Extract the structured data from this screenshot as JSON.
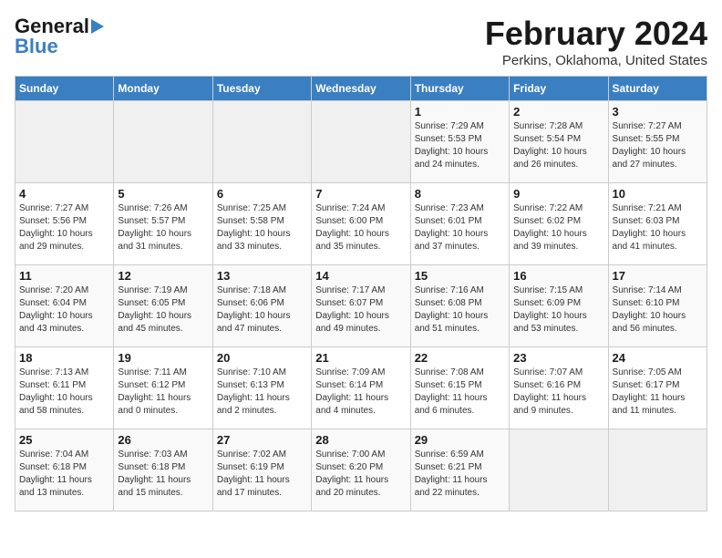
{
  "header": {
    "logo_line1": "General",
    "logo_line2": "Blue",
    "month_year": "February 2024",
    "location": "Perkins, Oklahoma, United States"
  },
  "weekdays": [
    "Sunday",
    "Monday",
    "Tuesday",
    "Wednesday",
    "Thursday",
    "Friday",
    "Saturday"
  ],
  "weeks": [
    [
      {
        "day": "",
        "info": ""
      },
      {
        "day": "",
        "info": ""
      },
      {
        "day": "",
        "info": ""
      },
      {
        "day": "",
        "info": ""
      },
      {
        "day": "1",
        "info": "Sunrise: 7:29 AM\nSunset: 5:53 PM\nDaylight: 10 hours\nand 24 minutes."
      },
      {
        "day": "2",
        "info": "Sunrise: 7:28 AM\nSunset: 5:54 PM\nDaylight: 10 hours\nand 26 minutes."
      },
      {
        "day": "3",
        "info": "Sunrise: 7:27 AM\nSunset: 5:55 PM\nDaylight: 10 hours\nand 27 minutes."
      }
    ],
    [
      {
        "day": "4",
        "info": "Sunrise: 7:27 AM\nSunset: 5:56 PM\nDaylight: 10 hours\nand 29 minutes."
      },
      {
        "day": "5",
        "info": "Sunrise: 7:26 AM\nSunset: 5:57 PM\nDaylight: 10 hours\nand 31 minutes."
      },
      {
        "day": "6",
        "info": "Sunrise: 7:25 AM\nSunset: 5:58 PM\nDaylight: 10 hours\nand 33 minutes."
      },
      {
        "day": "7",
        "info": "Sunrise: 7:24 AM\nSunset: 6:00 PM\nDaylight: 10 hours\nand 35 minutes."
      },
      {
        "day": "8",
        "info": "Sunrise: 7:23 AM\nSunset: 6:01 PM\nDaylight: 10 hours\nand 37 minutes."
      },
      {
        "day": "9",
        "info": "Sunrise: 7:22 AM\nSunset: 6:02 PM\nDaylight: 10 hours\nand 39 minutes."
      },
      {
        "day": "10",
        "info": "Sunrise: 7:21 AM\nSunset: 6:03 PM\nDaylight: 10 hours\nand 41 minutes."
      }
    ],
    [
      {
        "day": "11",
        "info": "Sunrise: 7:20 AM\nSunset: 6:04 PM\nDaylight: 10 hours\nand 43 minutes."
      },
      {
        "day": "12",
        "info": "Sunrise: 7:19 AM\nSunset: 6:05 PM\nDaylight: 10 hours\nand 45 minutes."
      },
      {
        "day": "13",
        "info": "Sunrise: 7:18 AM\nSunset: 6:06 PM\nDaylight: 10 hours\nand 47 minutes."
      },
      {
        "day": "14",
        "info": "Sunrise: 7:17 AM\nSunset: 6:07 PM\nDaylight: 10 hours\nand 49 minutes."
      },
      {
        "day": "15",
        "info": "Sunrise: 7:16 AM\nSunset: 6:08 PM\nDaylight: 10 hours\nand 51 minutes."
      },
      {
        "day": "16",
        "info": "Sunrise: 7:15 AM\nSunset: 6:09 PM\nDaylight: 10 hours\nand 53 minutes."
      },
      {
        "day": "17",
        "info": "Sunrise: 7:14 AM\nSunset: 6:10 PM\nDaylight: 10 hours\nand 56 minutes."
      }
    ],
    [
      {
        "day": "18",
        "info": "Sunrise: 7:13 AM\nSunset: 6:11 PM\nDaylight: 10 hours\nand 58 minutes."
      },
      {
        "day": "19",
        "info": "Sunrise: 7:11 AM\nSunset: 6:12 PM\nDaylight: 11 hours\nand 0 minutes."
      },
      {
        "day": "20",
        "info": "Sunrise: 7:10 AM\nSunset: 6:13 PM\nDaylight: 11 hours\nand 2 minutes."
      },
      {
        "day": "21",
        "info": "Sunrise: 7:09 AM\nSunset: 6:14 PM\nDaylight: 11 hours\nand 4 minutes."
      },
      {
        "day": "22",
        "info": "Sunrise: 7:08 AM\nSunset: 6:15 PM\nDaylight: 11 hours\nand 6 minutes."
      },
      {
        "day": "23",
        "info": "Sunrise: 7:07 AM\nSunset: 6:16 PM\nDaylight: 11 hours\nand 9 minutes."
      },
      {
        "day": "24",
        "info": "Sunrise: 7:05 AM\nSunset: 6:17 PM\nDaylight: 11 hours\nand 11 minutes."
      }
    ],
    [
      {
        "day": "25",
        "info": "Sunrise: 7:04 AM\nSunset: 6:18 PM\nDaylight: 11 hours\nand 13 minutes."
      },
      {
        "day": "26",
        "info": "Sunrise: 7:03 AM\nSunset: 6:18 PM\nDaylight: 11 hours\nand 15 minutes."
      },
      {
        "day": "27",
        "info": "Sunrise: 7:02 AM\nSunset: 6:19 PM\nDaylight: 11 hours\nand 17 minutes."
      },
      {
        "day": "28",
        "info": "Sunrise: 7:00 AM\nSunset: 6:20 PM\nDaylight: 11 hours\nand 20 minutes."
      },
      {
        "day": "29",
        "info": "Sunrise: 6:59 AM\nSunset: 6:21 PM\nDaylight: 11 hours\nand 22 minutes."
      },
      {
        "day": "",
        "info": ""
      },
      {
        "day": "",
        "info": ""
      }
    ]
  ]
}
